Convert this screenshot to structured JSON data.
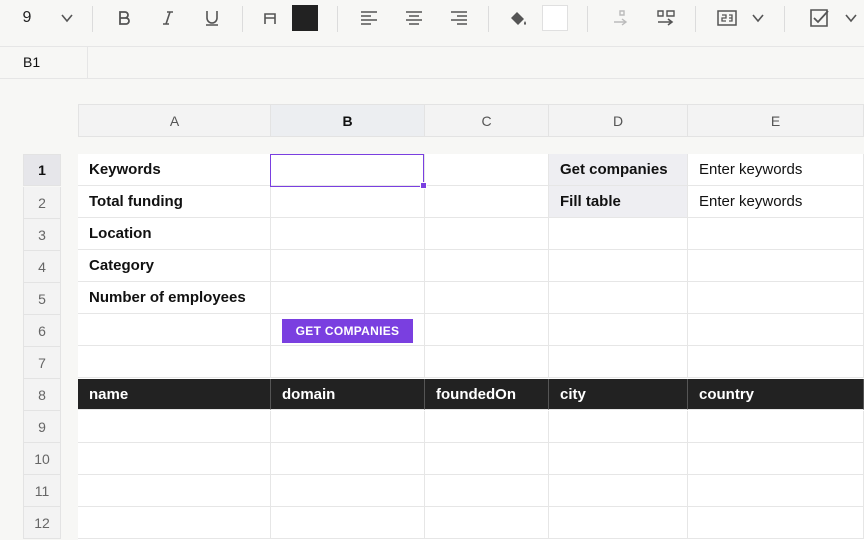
{
  "toolbar": {
    "font_size": "9",
    "fill_color": "#222222",
    "icons": [
      "chevron-down-icon",
      "bold-icon",
      "italic-icon",
      "underline-icon",
      "text-color-icon",
      "align-left-icon",
      "align-center-icon",
      "align-right-icon",
      "paint-bucket-icon",
      "wrap-text-icon",
      "merge-cells-icon",
      "number-format-icon",
      "checkbox-icon"
    ]
  },
  "formula_bar": {
    "cell_ref": "B1",
    "value": ""
  },
  "columns": [
    "A",
    "B",
    "C",
    "D",
    "E"
  ],
  "selected_column": "B",
  "rows": [
    "1",
    "2",
    "3",
    "4",
    "5",
    "6",
    "7",
    "8",
    "9",
    "10",
    "11",
    "12"
  ],
  "selected_row": "1",
  "cells": {
    "A1": "Keywords",
    "A2": "Total funding",
    "A3": "Location",
    "A4": "Category",
    "A5": "Number of employees",
    "D1": "Get companies",
    "D2": "Fill table",
    "E1": "Enter keywords",
    "E2": "Enter keywords"
  },
  "button": {
    "label": "GET COMPANIES",
    "color": "#7a3fe0"
  },
  "table_headers": [
    "name",
    "domain",
    "foundedOn",
    "city",
    "country"
  ],
  "accent_color": "#7a3fe0"
}
